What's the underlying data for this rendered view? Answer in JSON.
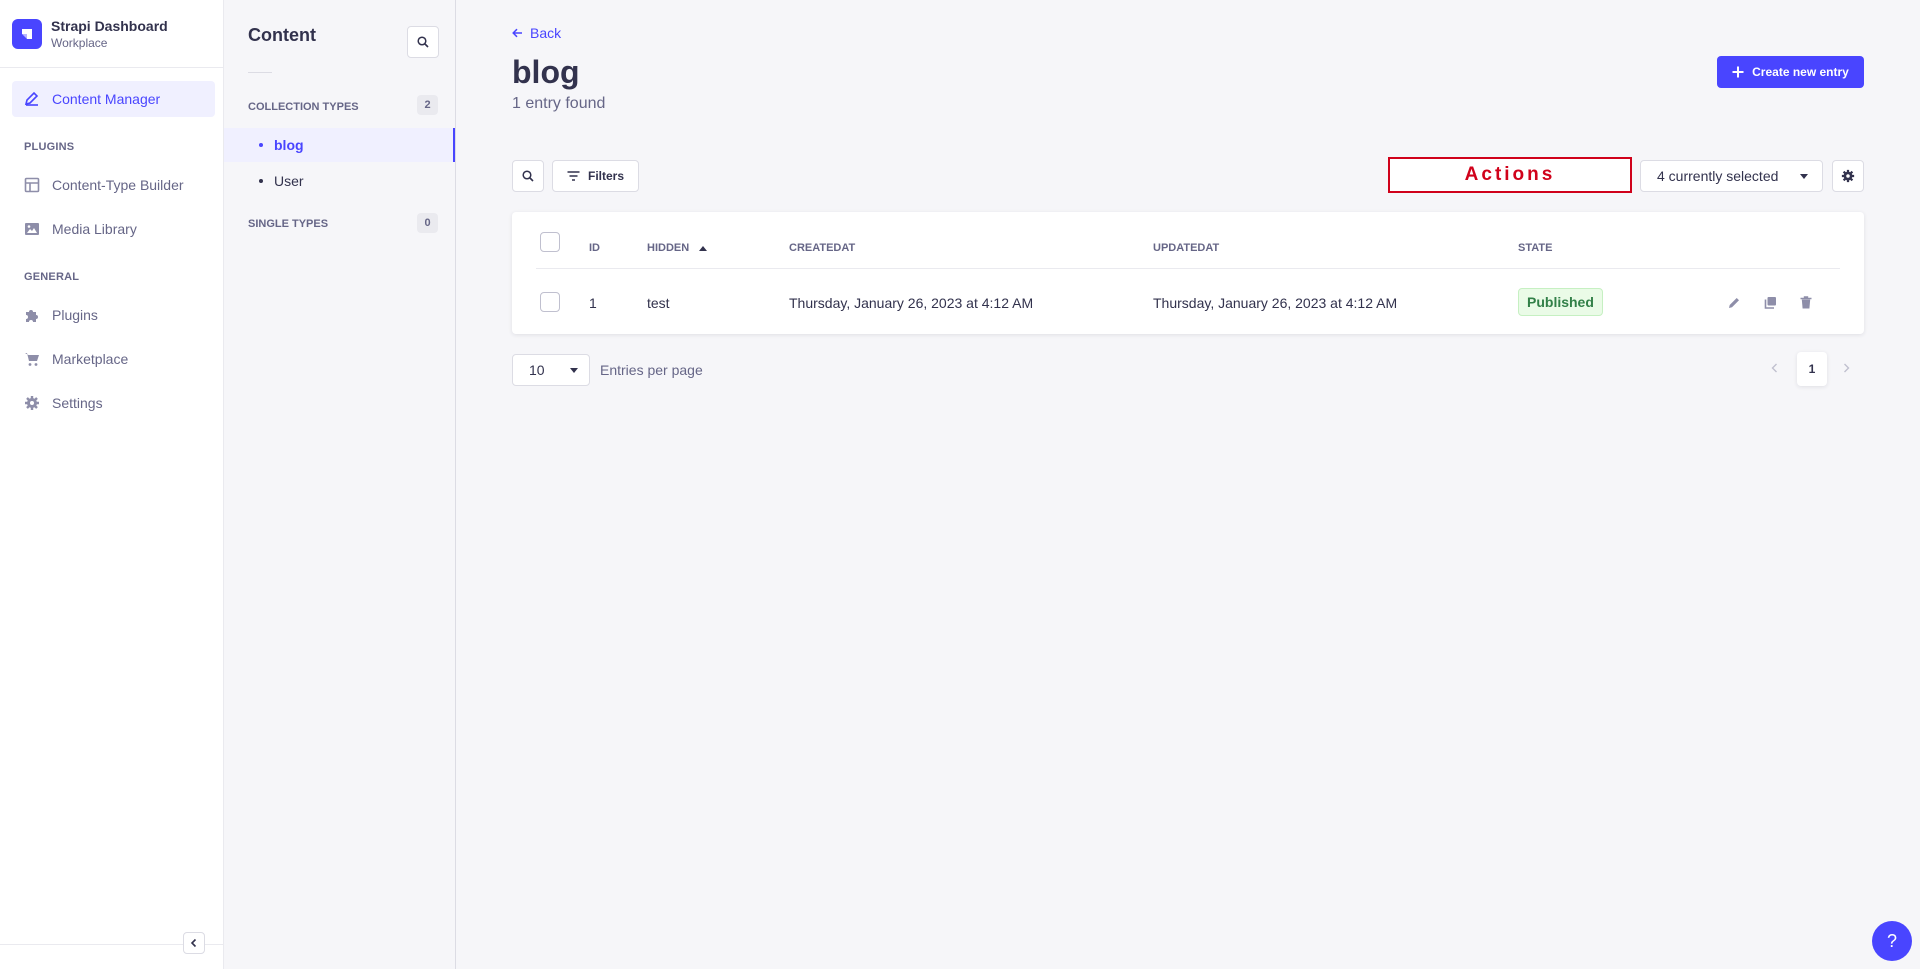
{
  "brand": {
    "title": "Strapi Dashboard",
    "subtitle": "Workplace"
  },
  "mainnav": {
    "content_manager": "Content Manager",
    "plugins_section": "PLUGINS",
    "content_type_builder": "Content-Type Builder",
    "media_library": "Media Library",
    "general_section": "GENERAL",
    "plugins": "Plugins",
    "marketplace": "Marketplace",
    "settings": "Settings"
  },
  "subnav": {
    "title": "Content",
    "collection_types_label": "COLLECTION TYPES",
    "collection_types_count": "2",
    "collection_items": [
      {
        "label": "blog",
        "active": true
      },
      {
        "label": "User",
        "active": false
      }
    ],
    "single_types_label": "SINGLE TYPES",
    "single_types_count": "0"
  },
  "header": {
    "back_label": "Back",
    "title": "blog",
    "subtitle": "1 entry found",
    "create_label": "Create new entry"
  },
  "toolbar": {
    "filters_label": "Filters",
    "actions_label": "Actions",
    "columns_select": "4 currently selected"
  },
  "table": {
    "columns": [
      "ID",
      "HIDDEN",
      "CREATEDAT",
      "UPDATEDAT",
      "STATE"
    ],
    "rows": [
      {
        "id": "1",
        "hidden": "test",
        "createdAt": "Thursday, January 26, 2023 at 4:12 AM",
        "updatedAt": "Thursday, January 26, 2023 at 4:12 AM",
        "state": "Published"
      }
    ]
  },
  "pagination": {
    "page_size": "10",
    "per_page_label": "Entries per page",
    "current_page": "1"
  },
  "help": {
    "label": "?"
  },
  "colors": {
    "primary": "#4945ff",
    "published_text": "#328048",
    "published_bg": "#eafbe7",
    "annotation": "#d0021b"
  }
}
